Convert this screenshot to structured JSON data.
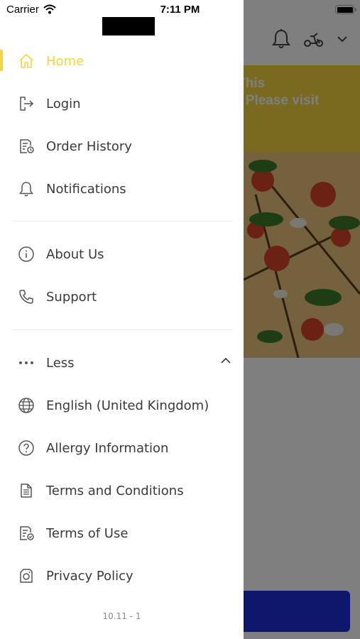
{
  "status_bar": {
    "carrier": "Carrier",
    "time": "7:11 PM"
  },
  "background": {
    "banner_text": "d, This\non. Please visit",
    "accent_color": "#f2d541",
    "button_color": "#1d2fd6"
  },
  "menu": {
    "primary": [
      {
        "label": "Home",
        "icon": "home-icon",
        "active": true
      },
      {
        "label": "Login",
        "icon": "login-icon"
      },
      {
        "label": "Order History",
        "icon": "order-history-icon"
      },
      {
        "label": "Notifications",
        "icon": "bell-icon"
      }
    ],
    "secondary": [
      {
        "label": "About Us",
        "icon": "info-icon"
      },
      {
        "label": "Support",
        "icon": "phone-icon"
      }
    ],
    "more": {
      "label": "Less",
      "icon": "more-dots-icon",
      "expanded": true
    },
    "extra": [
      {
        "label": "English (United Kingdom)",
        "icon": "globe-icon"
      },
      {
        "label": "Allergy Information",
        "icon": "question-icon"
      },
      {
        "label": "Terms and Conditions",
        "icon": "document-icon"
      },
      {
        "label": "Terms of Use",
        "icon": "document-check-icon"
      },
      {
        "label": "Privacy Policy",
        "icon": "privacy-icon"
      }
    ]
  },
  "version": "10.11 - 1"
}
